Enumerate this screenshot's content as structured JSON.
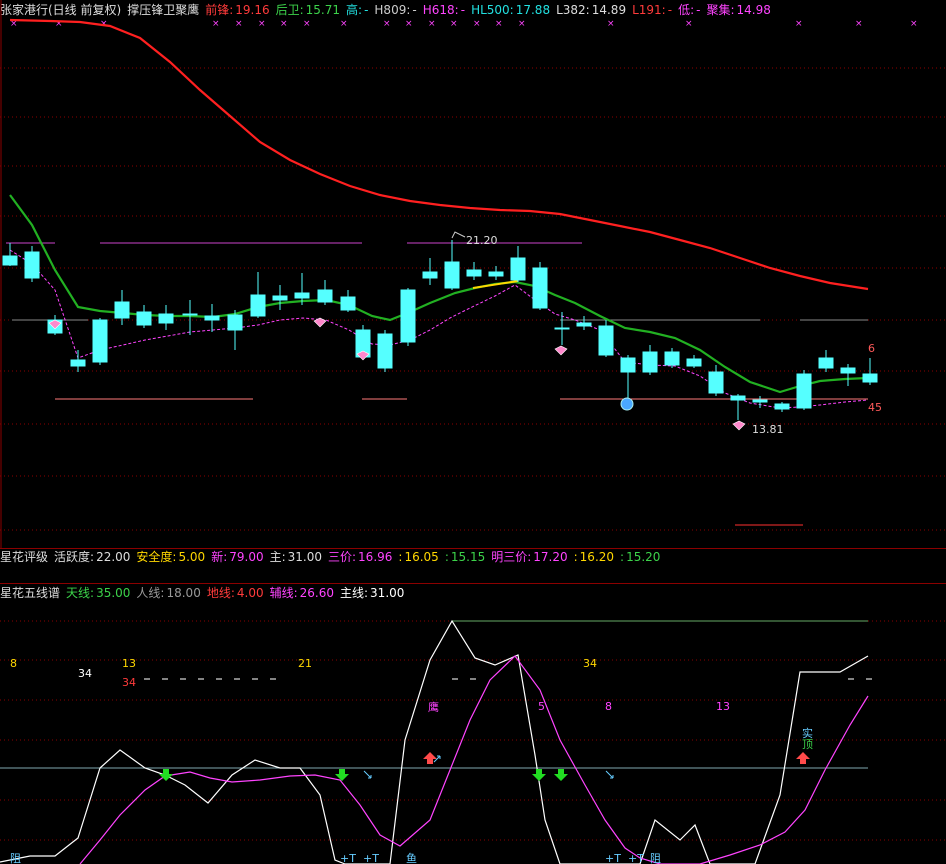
{
  "header": {
    "title": "张家港行(日线 前复权)",
    "indicator": "撑压锋卫聚鹰",
    "items": [
      {
        "label": "前锋:",
        "value": "19.16",
        "color": "#ff3b3b"
      },
      {
        "label": "后卫:",
        "value": "15.71",
        "color": "#3cd24a"
      },
      {
        "label": "高:",
        "value": "-",
        "color": "#22e0e0"
      },
      {
        "label": "H809:",
        "value": "-",
        "color": "#cccccc"
      },
      {
        "label": "H618:",
        "value": "-",
        "color": "#ff44ff"
      },
      {
        "label": "HL500:",
        "value": "17.88",
        "color": "#22e0e0"
      },
      {
        "label": "L382:",
        "value": "14.89",
        "color": "#dddddd"
      },
      {
        "label": "L191:",
        "value": "-",
        "color": "#ff3b3b"
      },
      {
        "label": "低:",
        "value": "-",
        "color": "#ff44ff"
      },
      {
        "label": "聚集:",
        "value": "14.98",
        "color": "#ff44ff"
      }
    ]
  },
  "price_chart": {
    "annotations": {
      "high": "21.20",
      "low": "13.81",
      "right_top": "6",
      "right_bottom": "45"
    }
  },
  "rating": {
    "name": "星花评级",
    "items": [
      {
        "label": "活跃度:",
        "value": "22.00",
        "color": "#dddddd"
      },
      {
        "label": "安全度:",
        "value": "5.00",
        "color": "#ffd700"
      },
      {
        "label": "新:",
        "value": "79.00",
        "color": "#ff44ff"
      },
      {
        "label": "主:",
        "value": "31.00",
        "color": "#dddddd"
      },
      {
        "label": "三价:",
        "value": "16.96",
        "color": "#ff44ff"
      },
      {
        "label": ":",
        "value": "16.05",
        "color": "#ffd700"
      },
      {
        "label": ":",
        "value": "15.15",
        "color": "#3cd24a"
      },
      {
        "label": "明三价:",
        "value": "17.20",
        "color": "#ff44ff"
      },
      {
        "label": ":",
        "value": "16.20",
        "color": "#ffd700"
      },
      {
        "label": ":",
        "value": "15.20",
        "color": "#3cd24a"
      }
    ]
  },
  "fiveline": {
    "name": "星花五线谱",
    "items": [
      {
        "label": "天线:",
        "value": "35.00",
        "color": "#3cd24a"
      },
      {
        "label": "人线:",
        "value": "18.00",
        "color": "#999999"
      },
      {
        "label": "地线:",
        "value": "4.00",
        "color": "#ff3b3b"
      },
      {
        "label": "辅线:",
        "value": "26.60",
        "color": "#ff44ff"
      },
      {
        "label": "主线:",
        "value": "31.00",
        "color": "#ffffff"
      }
    ],
    "fib_labels": [
      {
        "text": "8",
        "color": "#ffd700"
      },
      {
        "text": "34",
        "color": "#ffffff"
      },
      {
        "text": "13",
        "color": "#ffd700"
      },
      {
        "text": "34",
        "color": "#ff3b3b"
      },
      {
        "text": "21",
        "color": "#ffd700"
      },
      {
        "text": "34",
        "color": "#ffd700"
      },
      {
        "text": "5",
        "color": "#ff44ff"
      },
      {
        "text": "8",
        "color": "#ff44ff"
      },
      {
        "text": "13",
        "color": "#ff44ff"
      }
    ],
    "signal_labels": {
      "ying": "鹰",
      "bottom1": "+T",
      "bottom2": "+T",
      "yu": "鱼",
      "bottom3": "+T",
      "bottom4": "+T",
      "zu": "阻",
      "zu2": "阻",
      "shi": "实",
      "ding": "顶"
    }
  },
  "colors": {
    "bg": "#000000",
    "up": "#ff5a5a",
    "down": "#55ffff",
    "ma_red": "#ff2020",
    "ma_green": "#22b022",
    "dash_magenta": "#ff44ff"
  }
}
